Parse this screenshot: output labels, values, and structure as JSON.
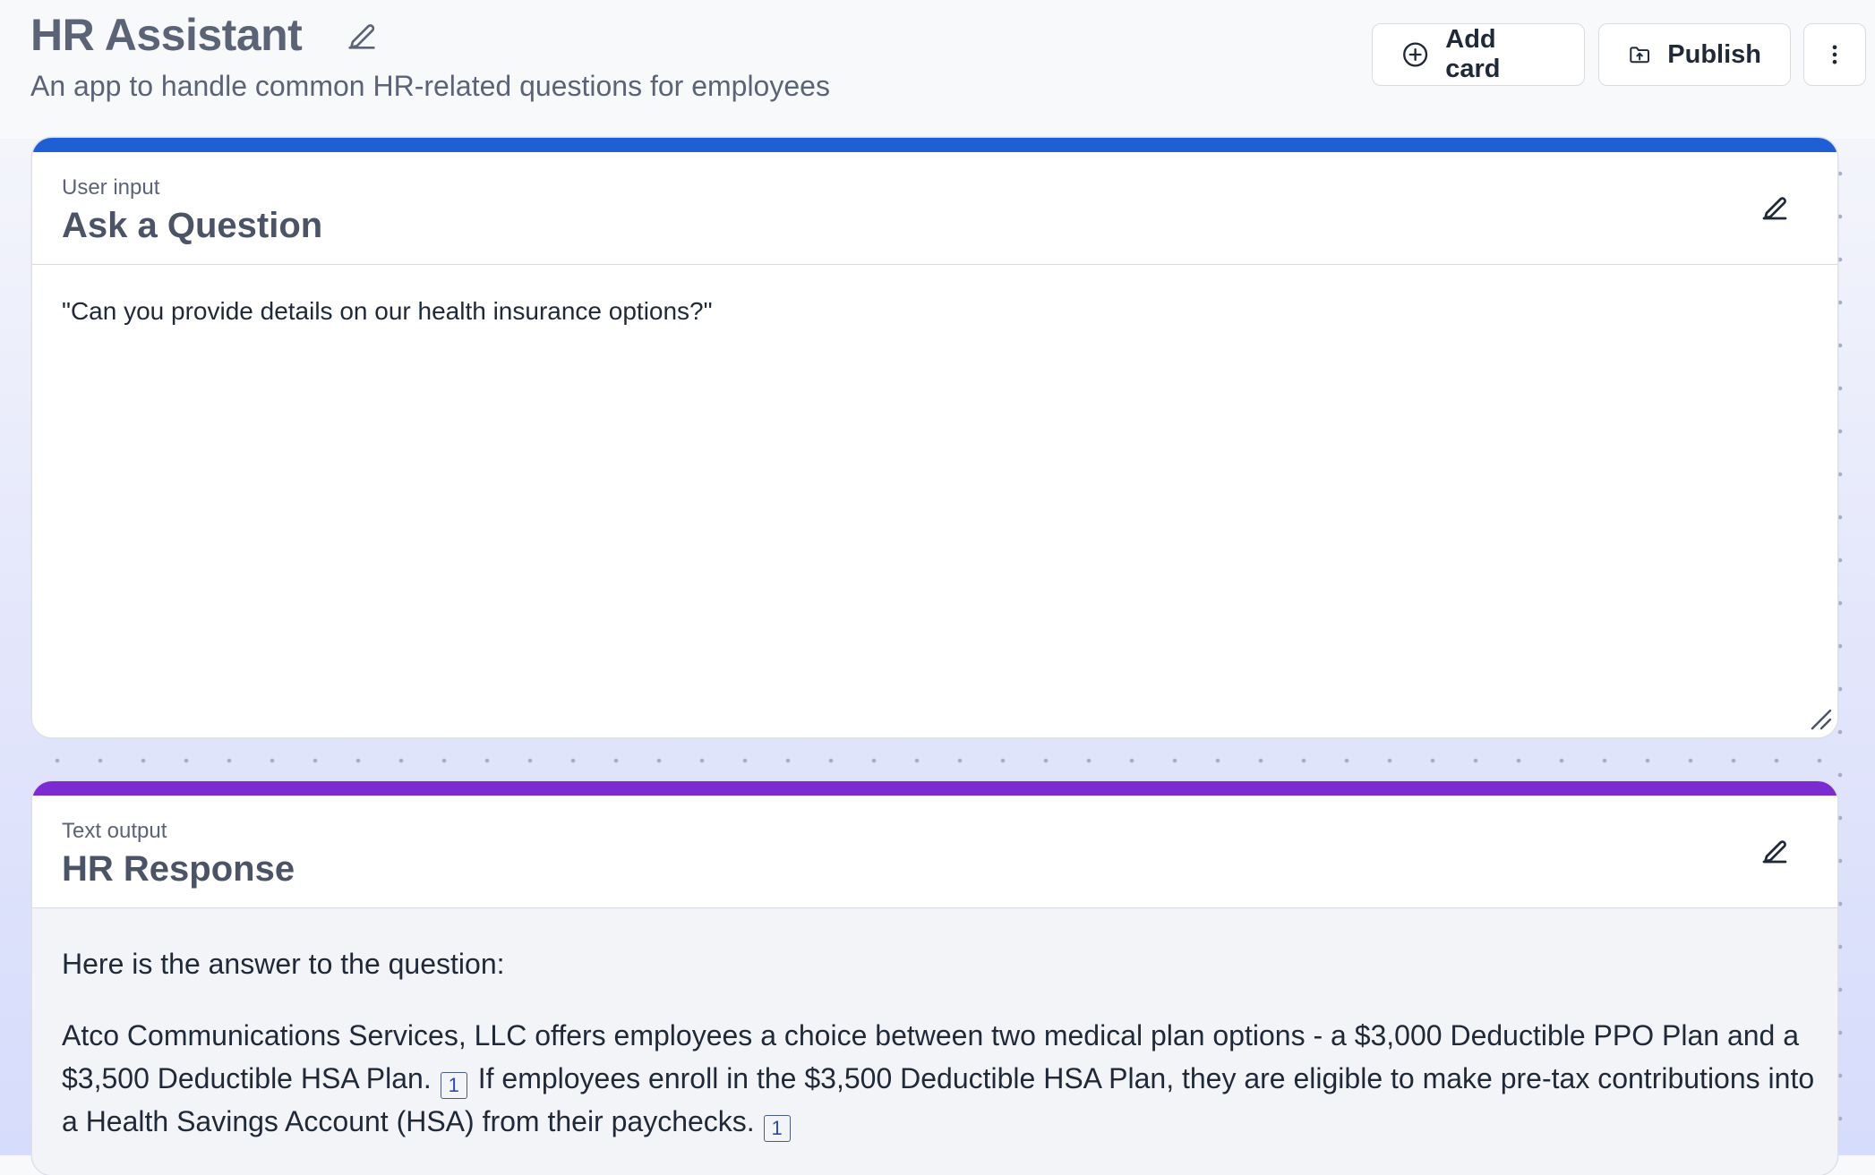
{
  "header": {
    "title": "HR Assistant",
    "subtitle": "An app to handle common HR-related questions for employees",
    "add_card_label": "Add card",
    "publish_label": "Publish",
    "title_edit_icon": "pencil-icon",
    "add_icon": "plus-circle-icon",
    "publish_icon": "folder-upload-icon",
    "more_icon": "vertical-dots-icon"
  },
  "cards": [
    {
      "kind": "User input",
      "title": "Ask a Question",
      "accent": "#1f5fd6",
      "value": "\"Can you provide details on our health insurance options?\""
    },
    {
      "kind": "Text output",
      "title": "HR Response",
      "accent": "#7c2bd3",
      "intro": "Here is the answer to the question:",
      "segments": [
        "Atco Communications Services, LLC offers employees a choice between two medical plan options - a $3,000 Deductible PPO Plan and a $3,500 Deductible HSA Plan.",
        "If employees enroll in the $3,500 Deductible HSA Plan, they are eligible to make pre-tax contributions into a Health Savings Account (HSA) from their paychecks."
      ],
      "citations": [
        "1",
        "1"
      ]
    }
  ]
}
